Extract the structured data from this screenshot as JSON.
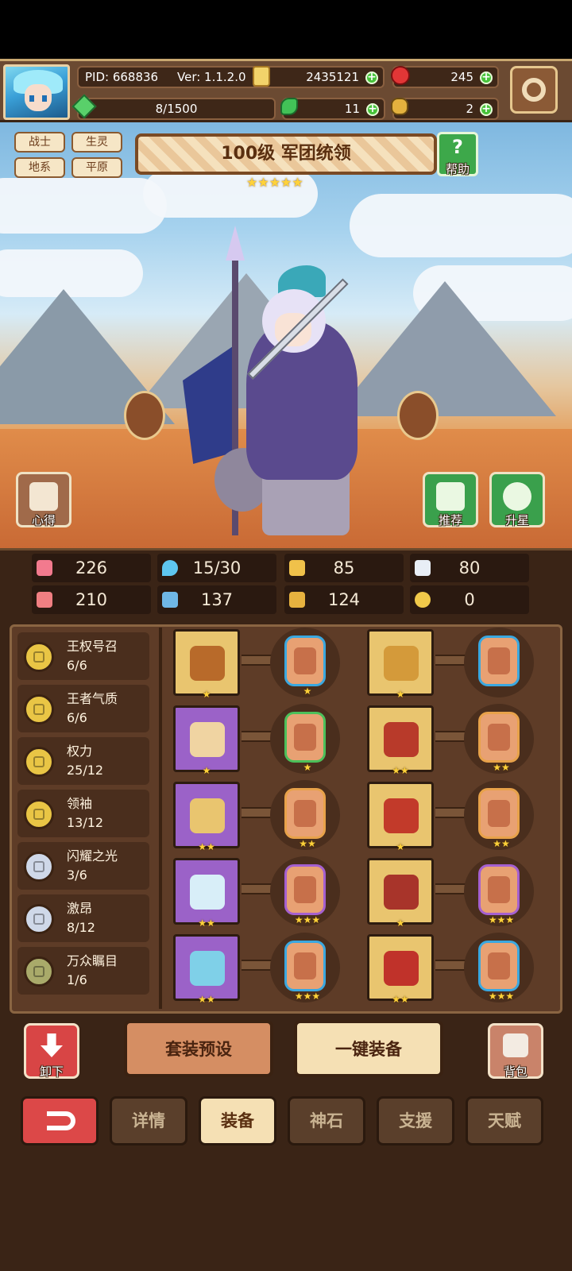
{
  "header": {
    "pid": "PID: 668836",
    "version": "Ver: 1.1.2.0",
    "gold": "2435121",
    "gems": "245",
    "energy": "8/1500",
    "clover": "11",
    "keys": "2",
    "icons": {
      "gold": "gold-coin-icon",
      "gems": "ruby-icon",
      "energy": "green-gem-icon",
      "clover": "clover-icon",
      "keys": "key-icon",
      "settings": "gear-icon"
    }
  },
  "hero": {
    "tags": [
      "战士",
      "生灵",
      "地系",
      "平原"
    ],
    "title": "100级 军团统领",
    "stars": "★★★★★",
    "help_label": "帮助",
    "notes_label": "心得",
    "recommend_label": "推荐",
    "star_up_label": "升星"
  },
  "stats": {
    "hp": "226",
    "mana": "15/30",
    "defense": "85",
    "speed": "80",
    "attack": "210",
    "magic": "137",
    "armor": "124",
    "luck": "0"
  },
  "sets": [
    {
      "name": "王权号召",
      "count": "6/6",
      "medal": "gold"
    },
    {
      "name": "王者气质",
      "count": "6/6",
      "medal": "gold"
    },
    {
      "name": "权力",
      "count": "25/12",
      "medal": "gold"
    },
    {
      "name": "领袖",
      "count": "13/12",
      "medal": "gold"
    },
    {
      "name": "闪耀之光",
      "count": "3/6",
      "medal": "silver"
    },
    {
      "name": "激昂",
      "count": "8/12",
      "medal": "silver"
    },
    {
      "name": "万众瞩目",
      "count": "1/6",
      "medal": "olive"
    }
  ],
  "equipment": [
    {
      "slot": "scepter",
      "frame": "gold",
      "stars": "★",
      "rune_stars": "★",
      "rune_border": "#3aa8e0"
    },
    {
      "slot": "crown",
      "frame": "gold",
      "stars": "★",
      "rune_stars": "",
      "rune_border": "#3aa8e0"
    },
    {
      "slot": "shield",
      "frame": "purple",
      "stars": "★",
      "rune_stars": "★",
      "rune_border": "#4cc05a"
    },
    {
      "slot": "armor",
      "frame": "gold",
      "stars": "★★",
      "rune_stars": "★★",
      "rune_border": "#e8a24a"
    },
    {
      "slot": "necklace",
      "frame": "purple",
      "stars": "★★",
      "rune_stars": "★★",
      "rune_border": "#e8a24a"
    },
    {
      "slot": "gloves",
      "frame": "gold",
      "stars": "★",
      "rune_stars": "★★",
      "rune_border": "#e8a24a"
    },
    {
      "slot": "gem",
      "frame": "purple",
      "stars": "★★",
      "rune_stars": "★★★",
      "rune_border": "#a560d0"
    },
    {
      "slot": "belt",
      "frame": "gold",
      "stars": "★",
      "rune_stars": "★★★",
      "rune_border": "#a560d0"
    },
    {
      "slot": "ring",
      "frame": "purple",
      "stars": "★★",
      "rune_stars": "★★★",
      "rune_border": "#3aa8e0"
    },
    {
      "slot": "boots",
      "frame": "gold",
      "stars": "★★",
      "rune_stars": "★★★",
      "rune_border": "#3aa8e0"
    }
  ],
  "actions": {
    "unequip": "卸下",
    "preset": "套装预设",
    "one_click": "一键装备",
    "bag": "背包"
  },
  "tabs": [
    {
      "label": "",
      "icon": "back-arrow-icon"
    },
    {
      "label": "详情"
    },
    {
      "label": "装备",
      "active": true
    },
    {
      "label": "神石"
    },
    {
      "label": "支援"
    },
    {
      "label": "天赋"
    }
  ]
}
